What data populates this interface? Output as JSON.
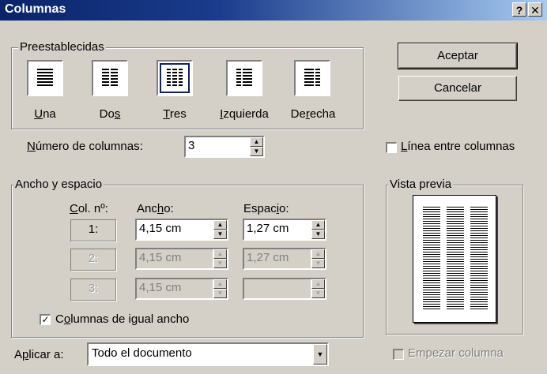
{
  "dialog": {
    "title": "Columnas",
    "help_label": "?",
    "close_label": "✕"
  },
  "presets": {
    "group_label": "Preestablecidas",
    "selected": "Tres",
    "items": [
      {
        "label": "Una",
        "mnemonic": "U"
      },
      {
        "label": "Dos",
        "mnemonic": "s"
      },
      {
        "label": "Tres",
        "mnemonic": "T"
      },
      {
        "label": "Izquierda",
        "mnemonic": "I"
      },
      {
        "label": "Derecha",
        "mnemonic": "r"
      }
    ]
  },
  "buttons": {
    "ok_label": "Aceptar",
    "cancel_label": "Cancelar"
  },
  "num_columns": {
    "label": "Número de columnas:",
    "value": "3"
  },
  "line_between": {
    "label": "Línea entre columnas",
    "checked": false
  },
  "width_spacing": {
    "group_label": "Ancho y espacio",
    "col_header": "Col. nº:",
    "width_header": "Ancho:",
    "spacing_header": "Espacio:",
    "rows": [
      {
        "col": "1:",
        "width": "4,15 cm",
        "spacing": "1,27 cm",
        "enabled": true
      },
      {
        "col": "2:",
        "width": "4,15 cm",
        "spacing": "1,27 cm",
        "enabled": false
      },
      {
        "col": "3:",
        "width": "4,15 cm",
        "spacing": "",
        "enabled": false
      }
    ],
    "equal_width_label": "Columnas de igual ancho",
    "equal_width_checked": true
  },
  "preview": {
    "group_label": "Vista previa",
    "column_count": 3
  },
  "apply_to": {
    "label": "Aplicar a:",
    "value": "Todo el documento"
  },
  "start_column": {
    "label": "Empezar columna",
    "checked": false,
    "enabled": false
  },
  "icons": {
    "spin_up": "up-arrow-icon",
    "spin_down": "down-arrow-icon",
    "dropdown": "dropdown-arrow-icon"
  }
}
